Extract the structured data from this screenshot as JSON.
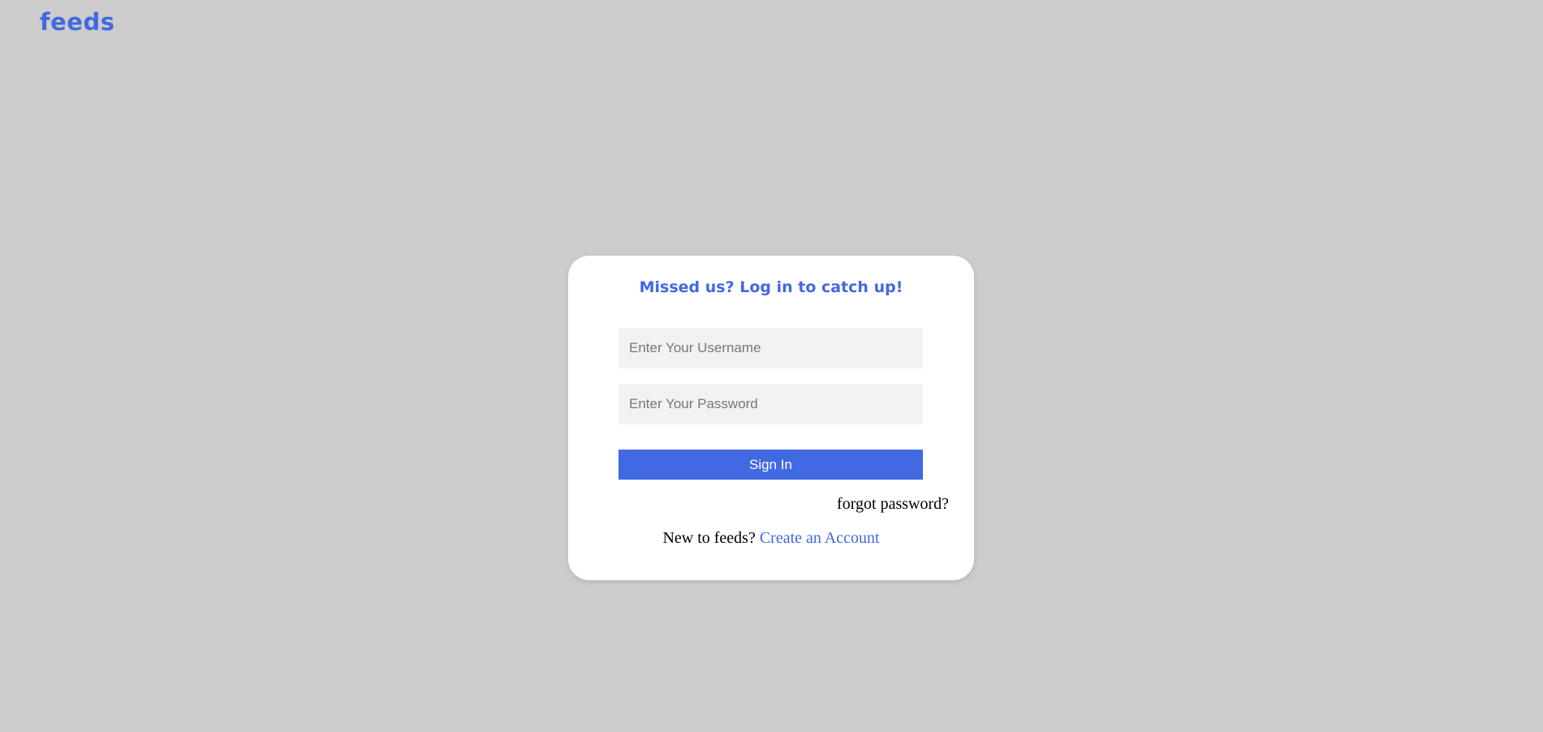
{
  "brand": {
    "logo_text": "feeds",
    "accent_color": "#4169e1"
  },
  "login": {
    "title": "Missed us? Log in to catch up!",
    "username": {
      "value": "",
      "placeholder": "Enter Your Username"
    },
    "password": {
      "value": "",
      "placeholder": "Enter Your Password"
    },
    "submit_label": "Sign In",
    "forgot_label": "forgot password?",
    "signup_prompt": "New to feeds?",
    "signup_link": "Create an Account"
  }
}
